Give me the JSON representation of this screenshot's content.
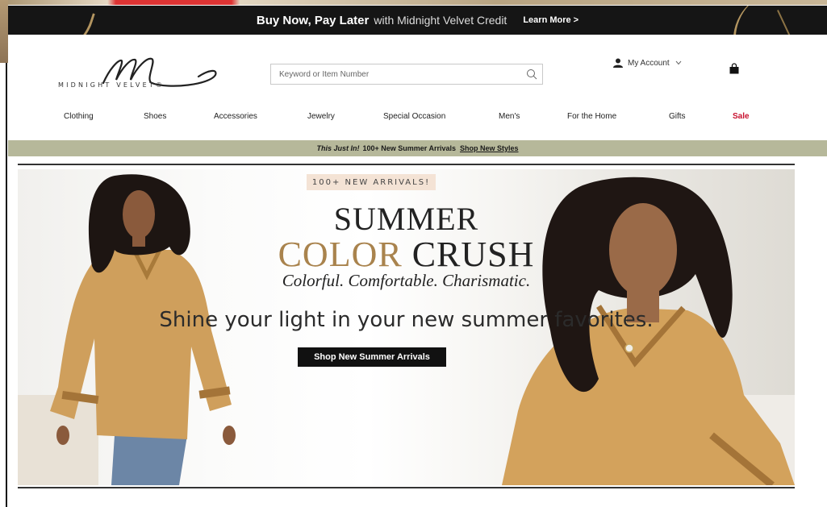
{
  "credit_banner": {
    "headline": "Buy Now, Pay Later",
    "subtext": "with Midnight Velvet Credit",
    "learn_more": "Learn More >"
  },
  "header": {
    "logo_text": "MIDNIGHT VELVET®",
    "search_placeholder": "Keyword or Item Number",
    "account_label": "My Account"
  },
  "nav": {
    "items": [
      "Clothing",
      "Shoes",
      "Accessories",
      "Jewelry",
      "Special Occasion",
      "Men's",
      "For the Home",
      "Gifts",
      "Sale"
    ]
  },
  "promo": {
    "lead": "This Just In!",
    "text": "100+ New Summer Arrivals",
    "link": "Shop New Styles"
  },
  "hero": {
    "badge": "100+ NEW ARRIVALS!",
    "title_line1": "SUMMER",
    "title_line2_accent": "COLOR",
    "title_line2_rest": "CRUSH",
    "tagline": "Colorful. Comfortable. Charismatic.",
    "subline": "Shine your light in your new summer favorites.",
    "cta": "Shop New Summer Arrivals"
  },
  "colors": {
    "credit_bar_bg": "#151515",
    "accent_gold": "#a9834d",
    "promo_bg": "#b6b89a",
    "sale_red": "#c8102e",
    "cta_bg": "#111111"
  }
}
